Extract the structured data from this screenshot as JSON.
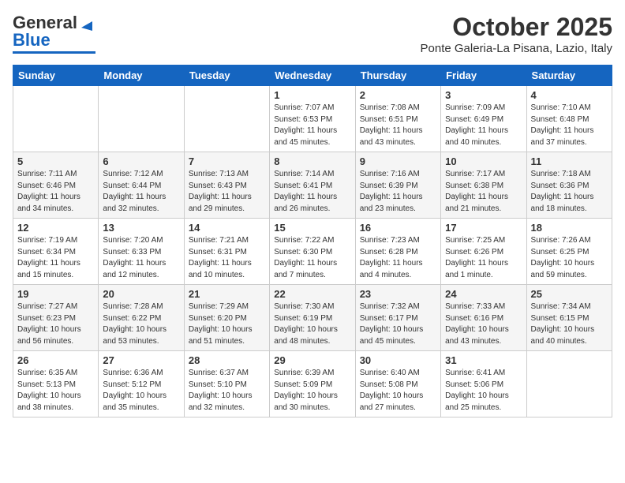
{
  "header": {
    "logo_general": "General",
    "logo_blue": "Blue",
    "month": "October 2025",
    "location": "Ponte Galeria-La Pisana, Lazio, Italy"
  },
  "days_of_week": [
    "Sunday",
    "Monday",
    "Tuesday",
    "Wednesday",
    "Thursday",
    "Friday",
    "Saturday"
  ],
  "weeks": [
    [
      {
        "day": "",
        "info": ""
      },
      {
        "day": "",
        "info": ""
      },
      {
        "day": "",
        "info": ""
      },
      {
        "day": "1",
        "info": "Sunrise: 7:07 AM\nSunset: 6:53 PM\nDaylight: 11 hours and 45 minutes."
      },
      {
        "day": "2",
        "info": "Sunrise: 7:08 AM\nSunset: 6:51 PM\nDaylight: 11 hours and 43 minutes."
      },
      {
        "day": "3",
        "info": "Sunrise: 7:09 AM\nSunset: 6:49 PM\nDaylight: 11 hours and 40 minutes."
      },
      {
        "day": "4",
        "info": "Sunrise: 7:10 AM\nSunset: 6:48 PM\nDaylight: 11 hours and 37 minutes."
      }
    ],
    [
      {
        "day": "5",
        "info": "Sunrise: 7:11 AM\nSunset: 6:46 PM\nDaylight: 11 hours and 34 minutes."
      },
      {
        "day": "6",
        "info": "Sunrise: 7:12 AM\nSunset: 6:44 PM\nDaylight: 11 hours and 32 minutes."
      },
      {
        "day": "7",
        "info": "Sunrise: 7:13 AM\nSunset: 6:43 PM\nDaylight: 11 hours and 29 minutes."
      },
      {
        "day": "8",
        "info": "Sunrise: 7:14 AM\nSunset: 6:41 PM\nDaylight: 11 hours and 26 minutes."
      },
      {
        "day": "9",
        "info": "Sunrise: 7:16 AM\nSunset: 6:39 PM\nDaylight: 11 hours and 23 minutes."
      },
      {
        "day": "10",
        "info": "Sunrise: 7:17 AM\nSunset: 6:38 PM\nDaylight: 11 hours and 21 minutes."
      },
      {
        "day": "11",
        "info": "Sunrise: 7:18 AM\nSunset: 6:36 PM\nDaylight: 11 hours and 18 minutes."
      }
    ],
    [
      {
        "day": "12",
        "info": "Sunrise: 7:19 AM\nSunset: 6:34 PM\nDaylight: 11 hours and 15 minutes."
      },
      {
        "day": "13",
        "info": "Sunrise: 7:20 AM\nSunset: 6:33 PM\nDaylight: 11 hours and 12 minutes."
      },
      {
        "day": "14",
        "info": "Sunrise: 7:21 AM\nSunset: 6:31 PM\nDaylight: 11 hours and 10 minutes."
      },
      {
        "day": "15",
        "info": "Sunrise: 7:22 AM\nSunset: 6:30 PM\nDaylight: 11 hours and 7 minutes."
      },
      {
        "day": "16",
        "info": "Sunrise: 7:23 AM\nSunset: 6:28 PM\nDaylight: 11 hours and 4 minutes."
      },
      {
        "day": "17",
        "info": "Sunrise: 7:25 AM\nSunset: 6:26 PM\nDaylight: 11 hours and 1 minute."
      },
      {
        "day": "18",
        "info": "Sunrise: 7:26 AM\nSunset: 6:25 PM\nDaylight: 10 hours and 59 minutes."
      }
    ],
    [
      {
        "day": "19",
        "info": "Sunrise: 7:27 AM\nSunset: 6:23 PM\nDaylight: 10 hours and 56 minutes."
      },
      {
        "day": "20",
        "info": "Sunrise: 7:28 AM\nSunset: 6:22 PM\nDaylight: 10 hours and 53 minutes."
      },
      {
        "day": "21",
        "info": "Sunrise: 7:29 AM\nSunset: 6:20 PM\nDaylight: 10 hours and 51 minutes."
      },
      {
        "day": "22",
        "info": "Sunrise: 7:30 AM\nSunset: 6:19 PM\nDaylight: 10 hours and 48 minutes."
      },
      {
        "day": "23",
        "info": "Sunrise: 7:32 AM\nSunset: 6:17 PM\nDaylight: 10 hours and 45 minutes."
      },
      {
        "day": "24",
        "info": "Sunrise: 7:33 AM\nSunset: 6:16 PM\nDaylight: 10 hours and 43 minutes."
      },
      {
        "day": "25",
        "info": "Sunrise: 7:34 AM\nSunset: 6:15 PM\nDaylight: 10 hours and 40 minutes."
      }
    ],
    [
      {
        "day": "26",
        "info": "Sunrise: 6:35 AM\nSunset: 5:13 PM\nDaylight: 10 hours and 38 minutes."
      },
      {
        "day": "27",
        "info": "Sunrise: 6:36 AM\nSunset: 5:12 PM\nDaylight: 10 hours and 35 minutes."
      },
      {
        "day": "28",
        "info": "Sunrise: 6:37 AM\nSunset: 5:10 PM\nDaylight: 10 hours and 32 minutes."
      },
      {
        "day": "29",
        "info": "Sunrise: 6:39 AM\nSunset: 5:09 PM\nDaylight: 10 hours and 30 minutes."
      },
      {
        "day": "30",
        "info": "Sunrise: 6:40 AM\nSunset: 5:08 PM\nDaylight: 10 hours and 27 minutes."
      },
      {
        "day": "31",
        "info": "Sunrise: 6:41 AM\nSunset: 5:06 PM\nDaylight: 10 hours and 25 minutes."
      },
      {
        "day": "",
        "info": ""
      }
    ]
  ]
}
